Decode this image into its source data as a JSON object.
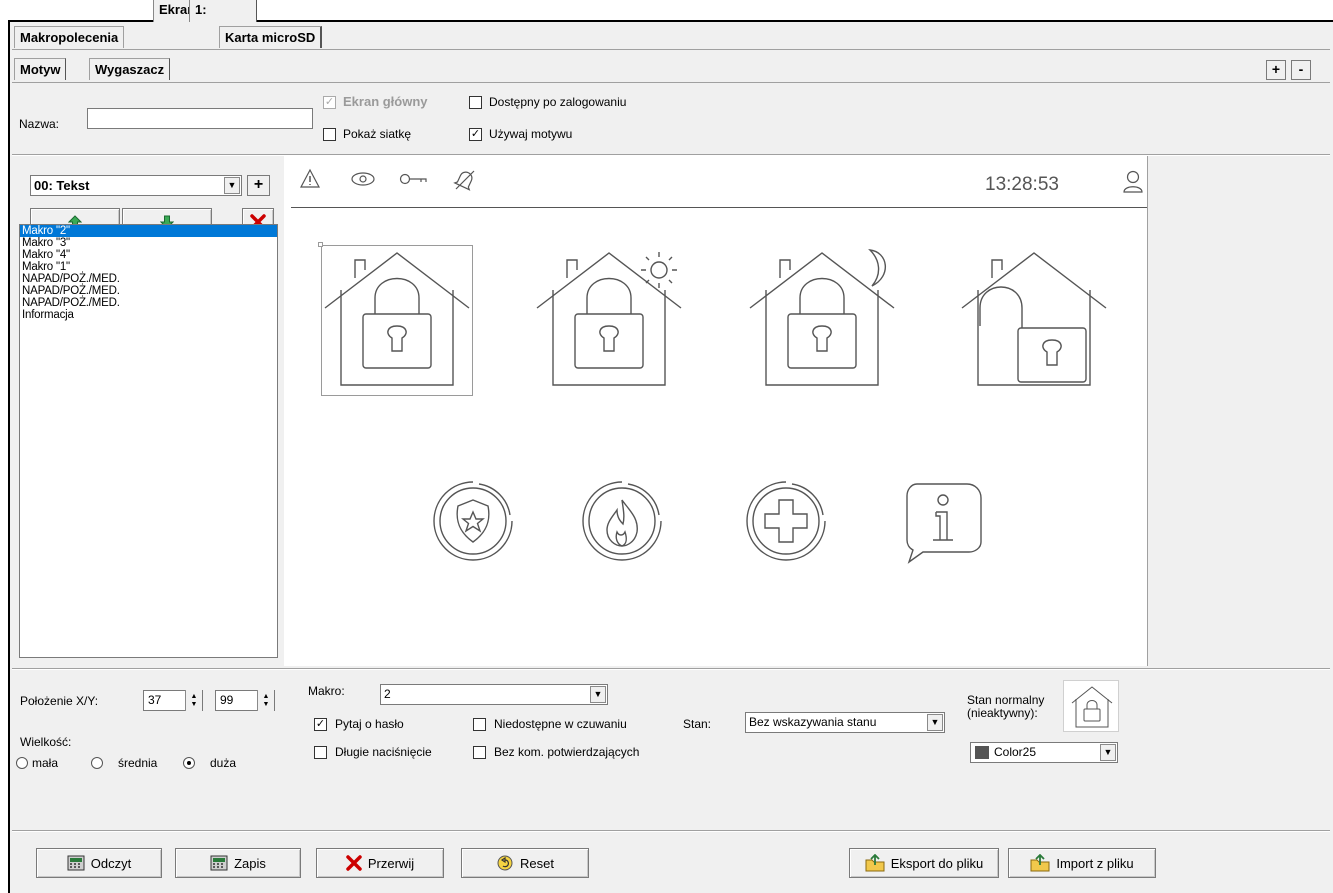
{
  "tabs_main": [
    "Makropolecenia",
    "Ekran",
    "Karta microSD"
  ],
  "tabs_sub": [
    "Motyw",
    "Wygaszacz",
    "1:"
  ],
  "plus_label": "+",
  "minus_label": "-",
  "name_label": "Nazwa:",
  "name_value": "",
  "options": {
    "main_screen": "Ekran główny",
    "available_after_login": "Dostępny po zalogowaniu",
    "show_grid": "Pokaż siatkę",
    "use_theme": "Używaj motywu"
  },
  "element_select": "00: Tekst",
  "add_label": "+",
  "list_items": [
    "Makro \"2\"",
    "Makro \"3\"",
    "Makro \"4\"",
    "Makro \"1\"",
    "NAPAD/POŻ./MED.",
    "NAPAD/POŻ./MED.",
    "NAPAD/POŻ./MED.",
    "Informacja"
  ],
  "preview": {
    "clock": "13:28:53"
  },
  "position": {
    "label": "Położenie X/Y:",
    "x": "37",
    "y": "99"
  },
  "size": {
    "label": "Wielkość:",
    "small": "mała",
    "medium": "średnia",
    "large": "duża"
  },
  "macro": {
    "label": "Makro:",
    "value": "2",
    "ask_password": "Pytaj o hasło",
    "unavailable_armed": "Niedostępne w czuwaniu",
    "long_press": "Długie naciśnięcie",
    "no_confirm": "Bez kom. potwierdzających"
  },
  "state": {
    "label": "Stan:",
    "value": "Bez wskazywania stanu",
    "normal_label_1": "Stan normalny",
    "normal_label_2": "(nieaktywny):",
    "color_value": "Color25",
    "color_swatch": "#555555"
  },
  "buttons": {
    "read": "Odczyt",
    "save": "Zapis",
    "abort": "Przerwij",
    "reset": "Reset",
    "export": "Eksport do pliku",
    "import": "Import z pliku"
  },
  "colors": {
    "selection": "#0078d7",
    "window_bg": "#f0f0f0",
    "icon_stroke": "#555555",
    "abort_red": "#cc0000"
  }
}
